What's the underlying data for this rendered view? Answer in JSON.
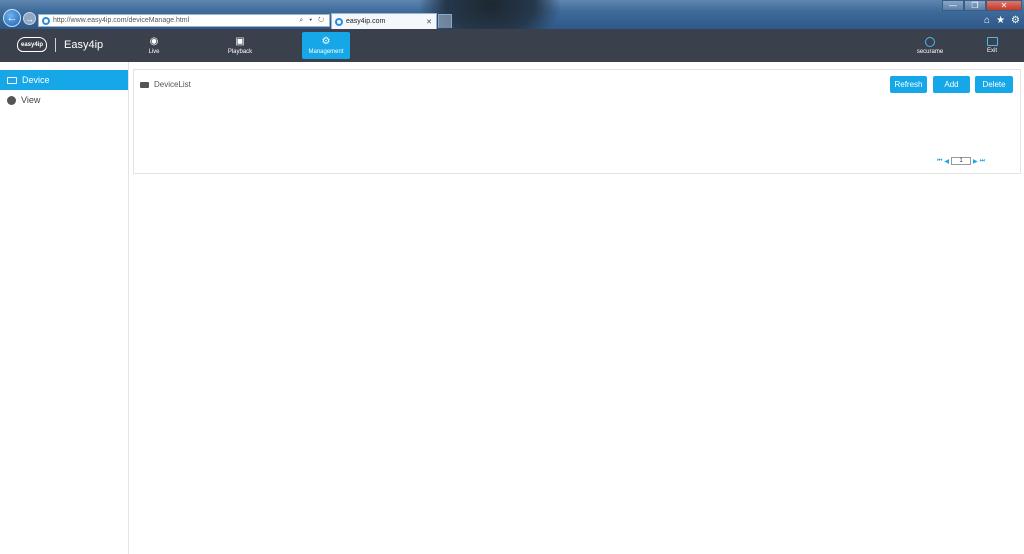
{
  "browser": {
    "url": "http://www.easy4ip.com/deviceManage.html",
    "tab_label": "easy4ip.com",
    "back_glyph": "←",
    "fwd_glyph": "→",
    "addr_tools": "⌕ ▾ ↻",
    "tab_close": "✕",
    "window_controls": [
      "—",
      "❐",
      "✕"
    ],
    "chrome_icons": [
      "⌂",
      "★",
      "⚙"
    ]
  },
  "app": {
    "logo_mark": "easy4ip",
    "logo_text": "Easy4ip",
    "nav": [
      {
        "label": "Live",
        "icon": "eye-icon"
      },
      {
        "label": "Playback",
        "icon": "film-icon"
      },
      {
        "label": "Management",
        "icon": "gear-icon"
      }
    ],
    "active_nav": "Management",
    "user_label": "securame",
    "exit_label": "Exit"
  },
  "sidebar": {
    "items": [
      {
        "label": "Device",
        "icon": "device-icon"
      },
      {
        "label": "View",
        "icon": "view-icon"
      }
    ],
    "active": "Device"
  },
  "panel": {
    "title": "DeviceList",
    "buttons": {
      "refresh": "Refresh",
      "add": "Add",
      "delete": "Delete"
    },
    "pager": {
      "first": "⏮",
      "prev": "◀",
      "page": "1",
      "next": "▶",
      "last": "⏭"
    }
  },
  "colors": {
    "accent": "#16a7e8",
    "header": "#3a414c"
  }
}
